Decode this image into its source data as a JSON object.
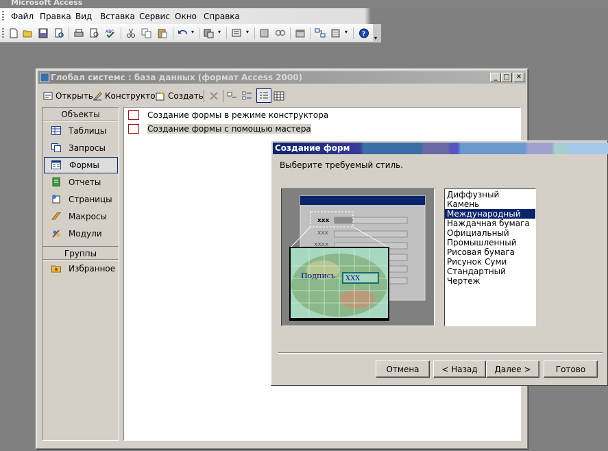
{
  "app": {
    "title": "Microsoft Access"
  },
  "menu": [
    "Файл",
    "Правка",
    "Вид",
    "Вставка",
    "Сервис",
    "Окно",
    "Справка"
  ],
  "db_window": {
    "title": "Глобал системс : база данных (формат Access 2000)",
    "toolbar": {
      "open": "Открыть",
      "design": "Конструктор",
      "create": "Создать"
    },
    "objects_header": "Объекты",
    "objects": [
      "Таблицы",
      "Запросы",
      "Формы",
      "Отчеты",
      "Страницы",
      "Макросы",
      "Модули"
    ],
    "selected_object": "Формы",
    "groups_header": "Группы",
    "groups": [
      "Избранное"
    ],
    "list_items": [
      "Создание формы в режиме конструктора",
      "Создание формы с помощью мастера"
    ]
  },
  "dialog": {
    "title": "Создание форм",
    "instruction": "Выберите требуемый стиль.",
    "styles": [
      "Диффузный",
      "Камень",
      "Международный",
      "Наждачная бумага",
      "Официальный",
      "Промышленный",
      "Рисовая бумага",
      "Рисунок Суми",
      "Стандартный",
      "Чертеж"
    ],
    "selected_style": "Международный",
    "preview": {
      "label": "Подпись",
      "value": "XXX",
      "placeholder_1": "xxx",
      "placeholder_2": "xxx",
      "placeholder_3": "xxxx"
    },
    "buttons": {
      "cancel": "Отмена",
      "back": "< Назад",
      "next": "Далее >",
      "finish": "Готово"
    }
  }
}
